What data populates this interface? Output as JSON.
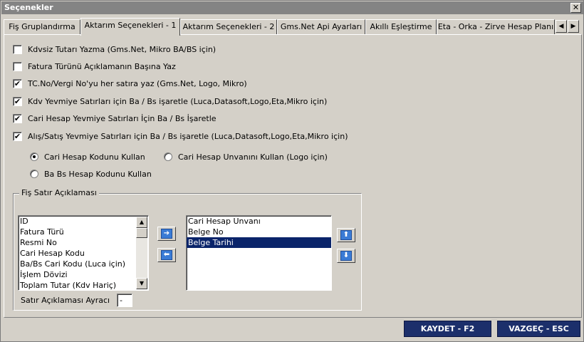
{
  "window": {
    "title": "Seçenekler",
    "close_glyph": "✕"
  },
  "tabs": [
    {
      "label": "Fiş Gruplandırma",
      "active": false
    },
    {
      "label": "Aktarım Seçenekleri - 1",
      "active": true
    },
    {
      "label": "Aktarım Seçenekleri - 2",
      "active": false
    },
    {
      "label": "Gms.Net Api Ayarları",
      "active": false
    },
    {
      "label": "Akıllı Eşleştirme",
      "active": false
    },
    {
      "label": "Eta - Orka - Zirve Hesap Planı",
      "active": false
    }
  ],
  "tab_scroll": {
    "left": "◀",
    "right": "▶"
  },
  "options": [
    {
      "label": "Kdvsiz Tutarı Yazma (Gms.Net, Mikro BA/BS için)",
      "checked": false
    },
    {
      "label": "Fatura Türünü Açıklamanın Başına Yaz",
      "checked": false
    },
    {
      "label": "TC.No/Vergi No'yu her satıra yaz (Gms.Net, Logo, Mikro)",
      "checked": true
    },
    {
      "label": "Kdv Yevmiye Satırları için Ba / Bs işaretle (Luca,Datasoft,Logo,Eta,Mikro için)",
      "checked": true
    },
    {
      "label": "Cari Hesap Yevmiye Satırları İçin Ba / Bs İşaretle",
      "checked": true
    },
    {
      "label": "Alış/Satış Yevmiye Satırları için Ba / Bs işaretle (Luca,Datasoft,Logo,Eta,Mikro için)",
      "checked": true
    }
  ],
  "radios": [
    {
      "label": "Cari Hesap Kodunu Kullan",
      "selected": true
    },
    {
      "label": "Cari Hesap Unvanını Kullan (Logo için)",
      "selected": false
    },
    {
      "label": "Ba Bs Hesap Kodunu Kullan",
      "selected": false
    }
  ],
  "group": {
    "title": "Fiş Satır Açıklaması",
    "available": [
      "ID",
      "Fatura Türü",
      "Resmi No",
      "Cari Hesap Kodu",
      "Ba/Bs Cari Kodu (Luca için)",
      "İşlem Dövizi",
      "Toplam Tutar (Kdv Hariç)"
    ],
    "selected_items": [
      "Cari Hesap Unvanı",
      "Belge No",
      "Belge Tarihi"
    ],
    "highlighted": "Belge Tarihi",
    "separator_label": "Satır Açıklaması Ayracı",
    "separator_value": "-",
    "arrows": {
      "add": "➔",
      "remove": "⬅",
      "up": "⬆",
      "down": "⬇",
      "scroll_up": "▲",
      "scroll_down": "▼"
    }
  },
  "footer": {
    "save_label": "KAYDET - F2",
    "cancel_label": "VAZGEÇ - ESC"
  },
  "colors": {
    "footer_button": "#1c2f6b",
    "selection": "#0a246a",
    "arrow_icon": "#3a7bd5"
  }
}
